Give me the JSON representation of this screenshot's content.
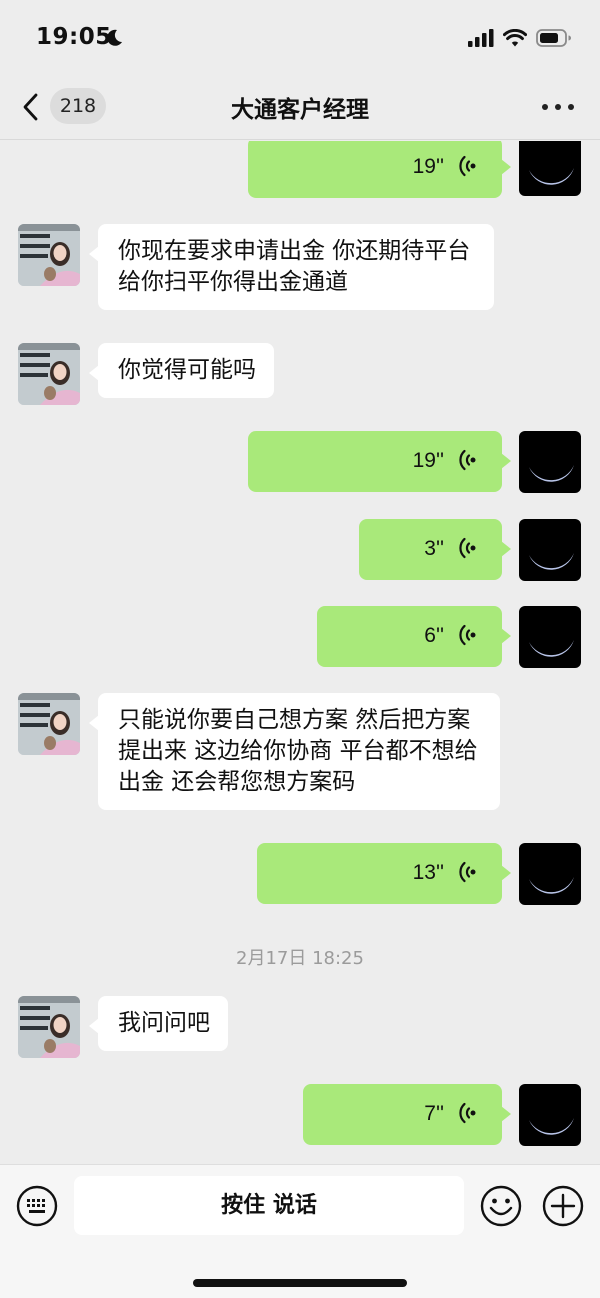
{
  "status_bar": {
    "time": "19:05",
    "focus_icon": "moon-icon",
    "icons": [
      "signal-icon",
      "wifi-icon",
      "battery-icon"
    ]
  },
  "nav": {
    "back_icon": "chevron-left-icon",
    "unread_count": "218",
    "title": "大通客户经理",
    "more_icon": "more-icon"
  },
  "messages": [
    {
      "side": "right",
      "type": "voice",
      "duration": "19''"
    },
    {
      "side": "left",
      "type": "text",
      "text": "你现在要求申请出金 你还期待平台给你扫平你得出金通道"
    },
    {
      "side": "left",
      "type": "text",
      "text": "你觉得可能吗"
    },
    {
      "side": "right",
      "type": "voice",
      "duration": "19''"
    },
    {
      "side": "right",
      "type": "voice",
      "duration": "3''"
    },
    {
      "side": "right",
      "type": "voice",
      "duration": "6''"
    },
    {
      "side": "left",
      "type": "text",
      "text": "只能说你要自己想方案 然后把方案提出来 这边给你协商 平台都不想给出金 还会帮您想方案码"
    },
    {
      "side": "right",
      "type": "voice",
      "duration": "13''"
    },
    {
      "type": "timestamp",
      "text": "2月17日 18:25"
    },
    {
      "side": "left",
      "type": "text",
      "text": "我问问吧"
    },
    {
      "side": "right",
      "type": "voice",
      "duration": "7''"
    }
  ],
  "input_bar": {
    "keyboard_icon": "keyboard-icon",
    "hold_to_talk_label": "按住 说话",
    "emoji_icon": "emoji-icon",
    "plus_icon": "plus-icon"
  },
  "colors": {
    "background": "#ededed",
    "outgoing_bubble": "#a9e97a",
    "incoming_bubble": "#ffffff",
    "timestamp_text": "#9b9b9b"
  }
}
